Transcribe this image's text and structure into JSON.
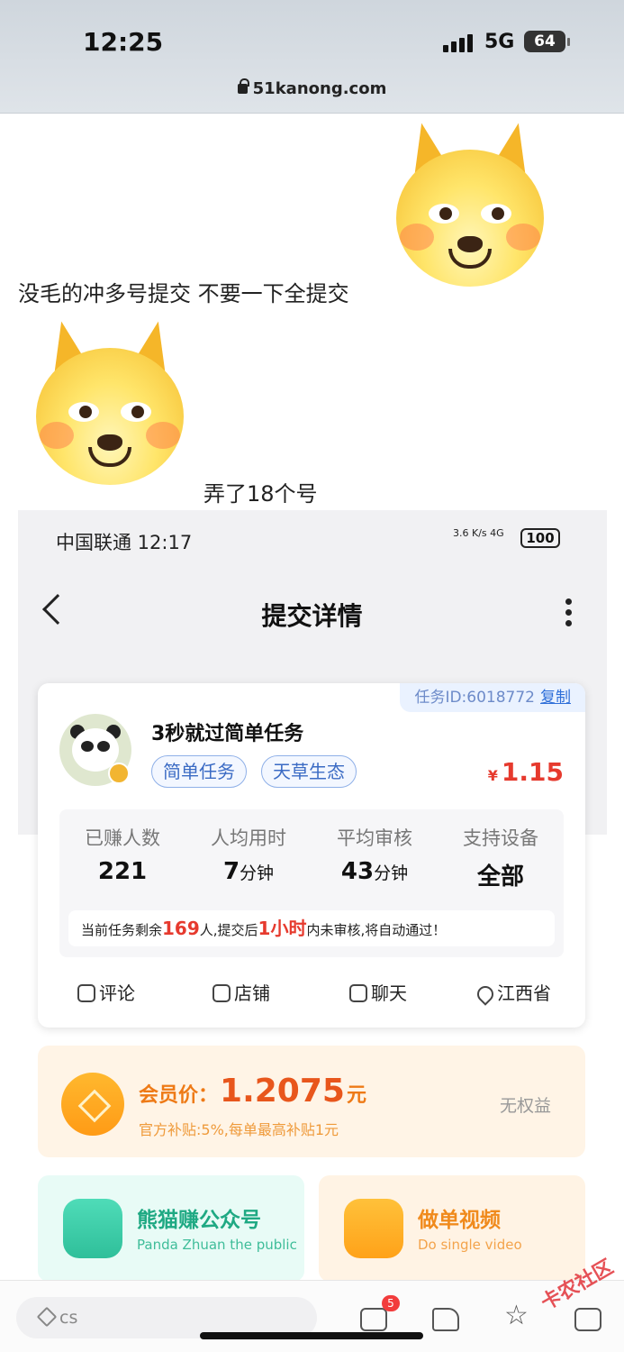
{
  "status_bar": {
    "time": "12:25",
    "network": "5G",
    "battery": "64"
  },
  "browser": {
    "url": "51kanong.com"
  },
  "post": {
    "line1": "没毛的冲多号提交 不要一下全提交",
    "line2": "弄了18个号"
  },
  "screenshot": {
    "status": {
      "carrier": "中国联通 12:17",
      "speed": "3.6 K/s 4G",
      "battery": "100"
    },
    "page_title": "提交详情",
    "task": {
      "id_label": "任务ID:6018772",
      "copy_label": "复制",
      "title": "3秒就过简单任务",
      "tags": [
        "简单任务",
        "天草生态"
      ],
      "currency": "¥",
      "price": "1.15",
      "stats": [
        {
          "label": "已赚人数",
          "value": "221",
          "unit": ""
        },
        {
          "label": "人均用时",
          "value": "7",
          "unit": "分钟"
        },
        {
          "label": "平均审核",
          "value": "43",
          "unit": "分钟"
        },
        {
          "label": "支持设备",
          "value": "全部",
          "unit": ""
        }
      ],
      "notice": {
        "a": "当前任务剩余",
        "remain": "169",
        "b": "人,提交后",
        "hours": "1小时",
        "c": "内未审核,将自动通过！"
      },
      "actions": [
        "评论",
        "店铺",
        "聊天",
        "江西省"
      ]
    },
    "vip": {
      "label": "会员价：",
      "price": "1.2075",
      "unit": "元",
      "subsidy": "官方补贴:5%,每单最高补贴1元",
      "rights": "无权益"
    },
    "promos": [
      {
        "title": "熊猫赚公众号",
        "subtitle": "Panda Zhuan the public"
      },
      {
        "title": "做单视频",
        "subtitle": "Do single video"
      }
    ]
  },
  "bottom_bar": {
    "comment_placeholder": "cs",
    "message_count": "5"
  },
  "watermark": "卡农社区",
  "colors": {
    "accent_red": "#e63a2e",
    "accent_blue": "#3b6bc4",
    "vip_orange": "#ee7a16"
  }
}
